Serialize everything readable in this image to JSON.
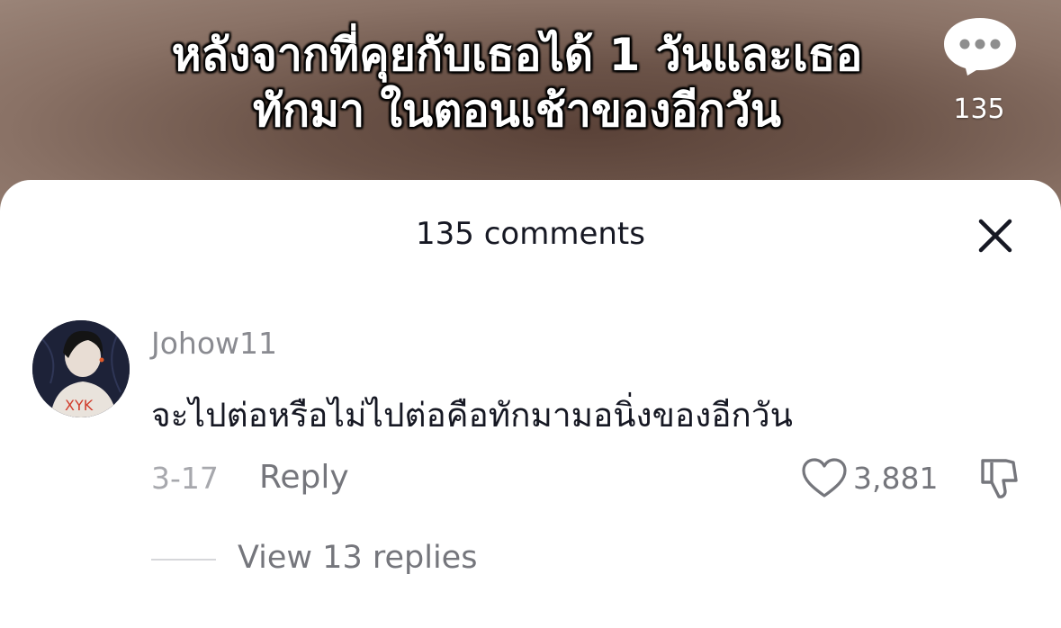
{
  "video": {
    "caption_line1": "หลังจากที่คุยกับเธอได้ 1 วันและเธอ",
    "caption_line2": "ทักมา ในตอนเช้าของอีกวัน",
    "comment_count": "135"
  },
  "sheet": {
    "title": "135 comments"
  },
  "comment": {
    "username": "Johow11",
    "text": "จะไปต่อหรือไม่ไปต่อคือทักมามอนิ่งของอีกวัน",
    "date": "3-17",
    "reply_label": "Reply",
    "like_count": "3,881",
    "view_replies_label": "View 13 replies"
  },
  "icons": {
    "comment": "comment-bubble-icon",
    "close": "close-icon",
    "like": "heart-outline-icon",
    "dislike": "thumbs-down-icon"
  }
}
